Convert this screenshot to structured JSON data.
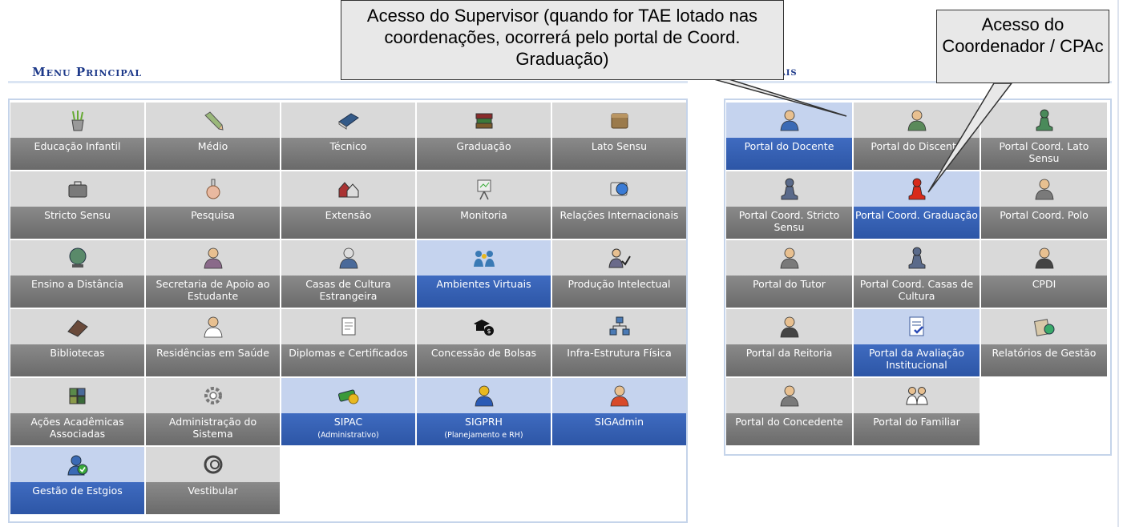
{
  "menu_principal": {
    "title": "Menu Principal"
  },
  "portais": {
    "title_visible_fragment": "ais"
  },
  "callouts": {
    "supervisor": "Acesso do Supervisor (quando for TAE lotado nas coordenações, ocorrerá pelo portal de Coord. Graduação)",
    "coordenador": "Acesso do Coordenador / CPAc"
  },
  "left_tiles": [
    {
      "label": "Educação Infantil",
      "icon": "pencil-cup-icon",
      "color": "gray"
    },
    {
      "label": "Médio",
      "icon": "pencil-icon",
      "color": "gray"
    },
    {
      "label": "Técnico",
      "icon": "book-icon",
      "color": "gray"
    },
    {
      "label": "Graduação",
      "icon": "books-stack-icon",
      "color": "gray"
    },
    {
      "label": "Lato Sensu",
      "icon": "folder-icon",
      "color": "gray"
    },
    {
      "label": "Stricto Sensu",
      "icon": "briefcase-icon",
      "color": "gray"
    },
    {
      "label": "Pesquisa",
      "icon": "flask-icon",
      "color": "gray"
    },
    {
      "label": "Extensão",
      "icon": "houses-icon",
      "color": "gray"
    },
    {
      "label": "Monitoria",
      "icon": "easel-icon",
      "color": "gray"
    },
    {
      "label": "Relações Internacionais",
      "icon": "globe-card-icon",
      "color": "gray"
    },
    {
      "label": "Ensino a Distância",
      "icon": "globe-icon",
      "color": "gray"
    },
    {
      "label": "Secretaria de Apoio ao Estudante",
      "icon": "student-support-icon",
      "color": "gray"
    },
    {
      "label": "Casas de Cultura Estrangeira",
      "icon": "culture-house-icon",
      "color": "gray"
    },
    {
      "label": "Ambientes Virtuais",
      "icon": "virtual-users-icon",
      "color": "blue"
    },
    {
      "label": "Produção Intelectual",
      "icon": "user-check-icon",
      "color": "gray"
    },
    {
      "label": "Bibliotecas",
      "icon": "library-icon",
      "color": "gray"
    },
    {
      "label": "Residências em Saúde",
      "icon": "doctor-icon",
      "color": "gray"
    },
    {
      "label": "Diplomas e Certificados",
      "icon": "certificate-icon",
      "color": "gray"
    },
    {
      "label": "Concessão de Bolsas",
      "icon": "graduation-money-icon",
      "color": "gray"
    },
    {
      "label": "Infra-Estrutura Física",
      "icon": "network-icon",
      "color": "gray"
    },
    {
      "label": "Ações Acadêmicas Associadas",
      "icon": "puzzle-icon",
      "color": "gray"
    },
    {
      "label": "Administração do Sistema",
      "icon": "gear-icon",
      "color": "gray"
    },
    {
      "label": "SIPAC",
      "sub": "(Administrativo)",
      "icon": "money-icon",
      "color": "blue"
    },
    {
      "label": "SIGPRH",
      "sub": "(Planejamento e RH)",
      "icon": "person-icon",
      "color": "blue"
    },
    {
      "label": "SIGAdmin",
      "icon": "admin-user-icon",
      "color": "blue"
    },
    {
      "label": "Gestão de Estgios",
      "icon": "internship-icon",
      "color": "blue"
    },
    {
      "label": "Vestibular",
      "icon": "spiral-icon",
      "color": "gray"
    }
  ],
  "right_tiles": [
    {
      "label": "Portal do Docente",
      "icon": "teacher-icon",
      "color": "blue"
    },
    {
      "label": "Portal do Discente",
      "icon": "student-icon",
      "color": "gray"
    },
    {
      "label": "Portal Coord. Lato Sensu",
      "icon": "pawn-green-icon",
      "color": "gray"
    },
    {
      "label": "Portal Coord. Stricto Sensu",
      "icon": "pawn-blue-icon",
      "color": "gray"
    },
    {
      "label": "Portal Coord. Graduação",
      "icon": "pawn-red-icon",
      "color": "blue"
    },
    {
      "label": "Portal Coord. Polo",
      "icon": "user-icon",
      "color": "gray"
    },
    {
      "label": "Portal do Tutor",
      "icon": "user-icon",
      "color": "gray"
    },
    {
      "label": "Portal Coord. Casas de Cultura",
      "icon": "pawn-blue-icon",
      "color": "gray"
    },
    {
      "label": "CPDI",
      "icon": "user-dark-icon",
      "color": "gray"
    },
    {
      "label": "Portal da Reitoria",
      "icon": "user-dark-icon",
      "color": "gray"
    },
    {
      "label": "Portal da Avaliação Institucional",
      "icon": "document-check-icon",
      "color": "blue"
    },
    {
      "label": "Relatórios de Gestão",
      "icon": "reports-icon",
      "color": "gray"
    },
    {
      "label": "Portal do Concedente",
      "icon": "user-icon",
      "color": "gray"
    },
    {
      "label": "Portal do Familiar",
      "icon": "family-icon",
      "color": "gray"
    }
  ]
}
